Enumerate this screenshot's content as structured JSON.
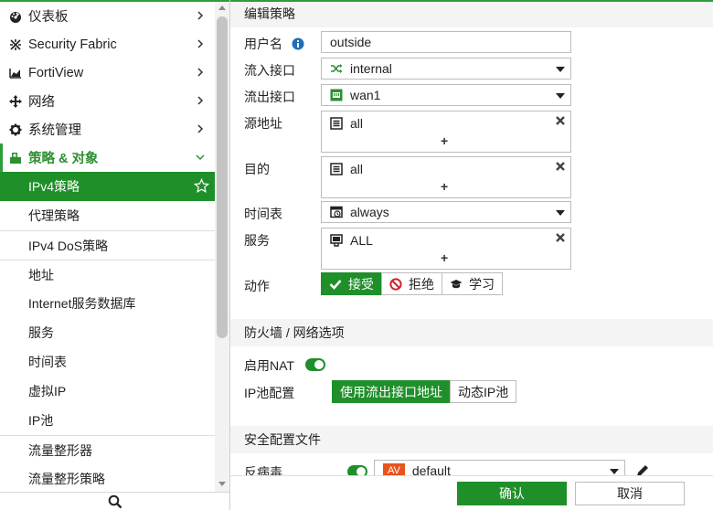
{
  "sidebar": {
    "top_items": [
      {
        "label": "仪表板",
        "icon": "dashboard-icon"
      },
      {
        "label": "Security Fabric",
        "icon": "security-fabric-icon"
      },
      {
        "label": "FortiView",
        "icon": "fortiview-icon"
      },
      {
        "label": "网络",
        "icon": "network-icon"
      },
      {
        "label": "系统管理",
        "icon": "gear-icon"
      }
    ],
    "open_item": {
      "label": "策略 & 对象",
      "icon": "policy-icon"
    },
    "sub_items": [
      {
        "label": "IPv4策略"
      },
      {
        "label": "代理策略"
      },
      {
        "label": "IPv4 DoS策略"
      },
      {
        "label": "地址"
      },
      {
        "label": "Internet服务数据库"
      },
      {
        "label": "服务"
      },
      {
        "label": "时间表"
      },
      {
        "label": "虚拟IP"
      },
      {
        "label": "IP池"
      },
      {
        "label": "流量整形器"
      },
      {
        "label": "流量整形策略"
      }
    ]
  },
  "main": {
    "section_edit": "编辑策略",
    "name_label": "用户名",
    "name_value": "outside",
    "incoming_label": "流入接口",
    "incoming_value": "internal",
    "outgoing_label": "流出接口",
    "outgoing_value": "wan1",
    "source_label": "源地址",
    "source_value": "all",
    "dest_label": "目的",
    "dest_value": "all",
    "schedule_label": "时间表",
    "schedule_value": "always",
    "service_label": "服务",
    "service_value": "ALL",
    "plus": "+",
    "action_label": "动作",
    "action_accept": "接受",
    "action_deny": "拒绝",
    "action_learn": "学习",
    "section_firewall": "防火墙 / 网络选项",
    "nat_label": "启用NAT",
    "ippool_label": "IP池配置",
    "ippool_option1": "使用流出接口地址",
    "ippool_option2": "动态IP池",
    "section_security": "安全配置文件",
    "av_label": "反病毒",
    "av_badge": "AV",
    "av_value": "default"
  },
  "footer": {
    "ok": "确认",
    "cancel": "取消"
  },
  "colors": {
    "accent": "#1f8f2a",
    "accent_line": "#2d9e3a",
    "av_badge": "#e8541e"
  }
}
